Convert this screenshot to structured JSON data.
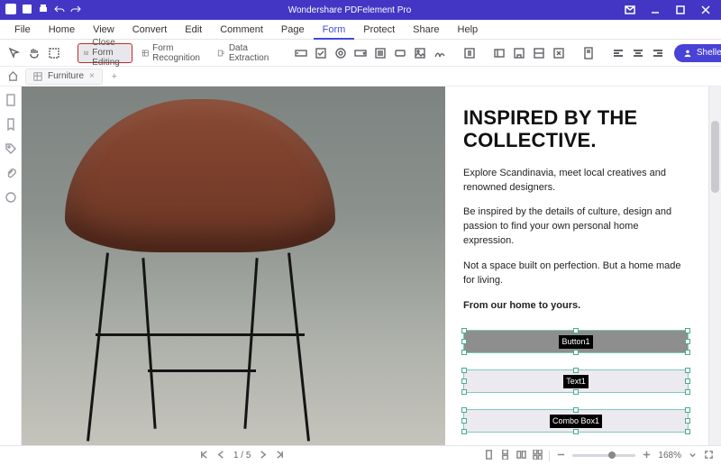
{
  "app_title": "Wondershare PDFelement Pro",
  "menus": [
    "File",
    "Home",
    "View",
    "Convert",
    "Edit",
    "Comment",
    "Page",
    "Form",
    "Protect",
    "Share",
    "Help"
  ],
  "active_menu": "Form",
  "ribbon": {
    "close_form_editing": "Close Form Editing",
    "form_recognition": "Form Recognition",
    "data_extraction": "Data Extraction"
  },
  "user": "Shelley",
  "doc_tab": {
    "icon": "table-icon",
    "label": "Furniture"
  },
  "document": {
    "heading": "INSPIRED BY THE COLLECTIVE.",
    "p1": "Explore Scandinavia, meet local creatives and renowned designers.",
    "p2": "Be inspired by the details of culture, design and passion to find your own personal home expression.",
    "p3": "Not a space built on perfection. But a home made for living.",
    "tagline": "From our home to yours.",
    "fields": {
      "button": "Button1",
      "text": "Text1",
      "combo": "Combo Box1"
    }
  },
  "status": {
    "page_current": "1",
    "page_total": "5",
    "zoom_pct": "168%"
  }
}
